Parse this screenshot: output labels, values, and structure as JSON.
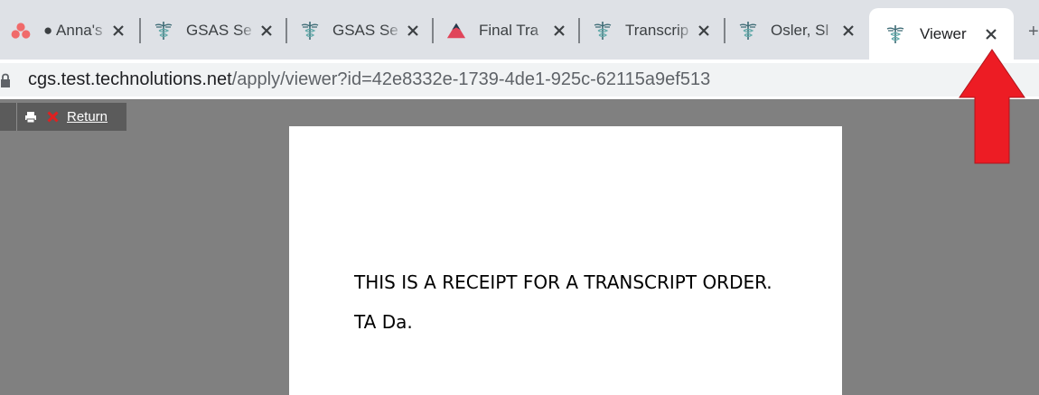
{
  "tabs": [
    {
      "title": "● Anna's",
      "icon": "asana-icon",
      "active": false
    },
    {
      "title": "GSAS Se",
      "icon": "caduceus-icon",
      "active": false
    },
    {
      "title": "GSAS Se",
      "icon": "caduceus-icon",
      "active": false
    },
    {
      "title": "Final Tra",
      "icon": "triangle-icon",
      "active": false
    },
    {
      "title": "Transcrip",
      "icon": "caduceus-icon",
      "active": false
    },
    {
      "title": "Osler, Sl",
      "icon": "caduceus-icon",
      "active": false
    },
    {
      "title": "Viewer",
      "icon": "caduceus-icon",
      "active": true
    }
  ],
  "address_bar": {
    "host": "cgs.test.technolutions.net",
    "path": "/apply/viewer?id=42e8332e-1739-4de1-925c-62115a9ef513"
  },
  "viewer_toolbar": {
    "return_label": "Return"
  },
  "document": {
    "line1": "THIS IS A RECEIPT FOR A TRANSCRIPT ORDER.",
    "line2": "TA Da."
  },
  "colors": {
    "annotation_arrow": "#ed1c24",
    "tabstrip_bg": "#dee1e6",
    "viewer_bg": "#808080"
  }
}
